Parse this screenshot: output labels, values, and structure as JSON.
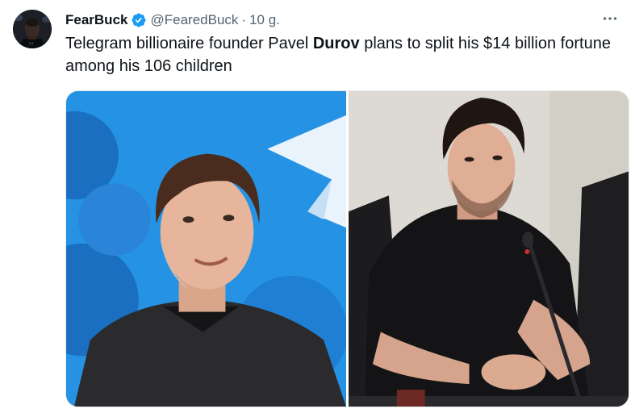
{
  "tweet": {
    "display_name": "FearBuck",
    "handle": "@FearedBuck",
    "separator": "·",
    "time": "10 g.",
    "text_before": "Telegram billionaire founder Pavel ",
    "text_bold": "Durov",
    "text_after": " plans to split his $14 billion fortune among his 106 children"
  },
  "icons": {
    "verified": "verified-badge-icon",
    "more": "more-options-icon"
  },
  "colors": {
    "verified_blue": "#1d9bf0",
    "text_primary": "#0f1419",
    "text_secondary": "#536471",
    "telegram_blue": "#2592e3"
  },
  "media": {
    "count": 2
  }
}
